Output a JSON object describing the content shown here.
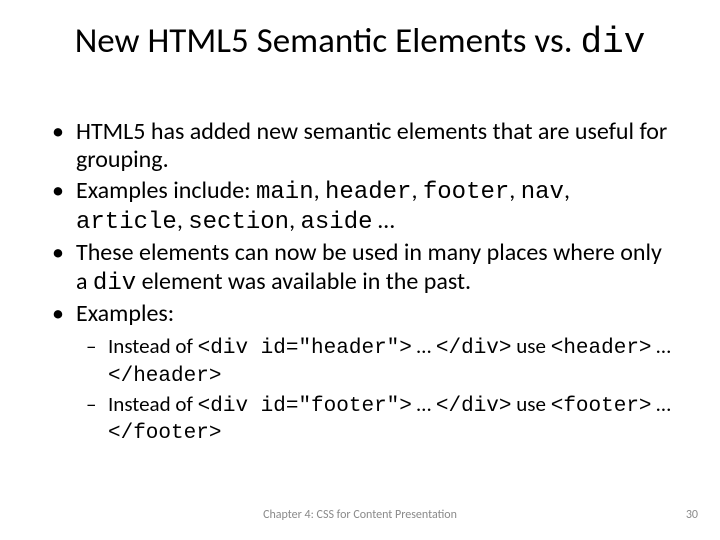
{
  "title": {
    "prefix": "New HTML5 Semantic Elements vs. ",
    "code": "div"
  },
  "bullets": {
    "b1": "HTML5 has added new semantic elements that are useful for grouping.",
    "b2": {
      "lead": "Examples include: ",
      "c1": "main",
      "s1": ", ",
      "c2": "header",
      "s2": ", ",
      "c3": "footer",
      "s3": ", ",
      "c4": "nav",
      "s4": ", ",
      "c5": "article",
      "s5": ", ",
      "c6": "section",
      "s6": ", ",
      "c7": "aside",
      "tail": " …"
    },
    "b3": {
      "t1": "These elements can now be used in many places where only a ",
      "c1": "div",
      "t2": " element was available in the past."
    },
    "b4": "Examples:"
  },
  "sub": {
    "s1": {
      "t1": "Instead of ",
      "c1": "<div id=\"header\">",
      "t2": " … ",
      "c2": "</div>",
      "t3": " use ",
      "c3": "<header>",
      "t4": " … ",
      "c4": "</header>"
    },
    "s2": {
      "t1": "Instead of ",
      "c1": "<div id=\"footer\">",
      "t2": " … ",
      "c2": "</div>",
      "t3": " use ",
      "c3": "<footer>",
      "t4": " … ",
      "c4": "</footer>"
    }
  },
  "footer": "Chapter 4: CSS for Content Presentation",
  "page": "30"
}
